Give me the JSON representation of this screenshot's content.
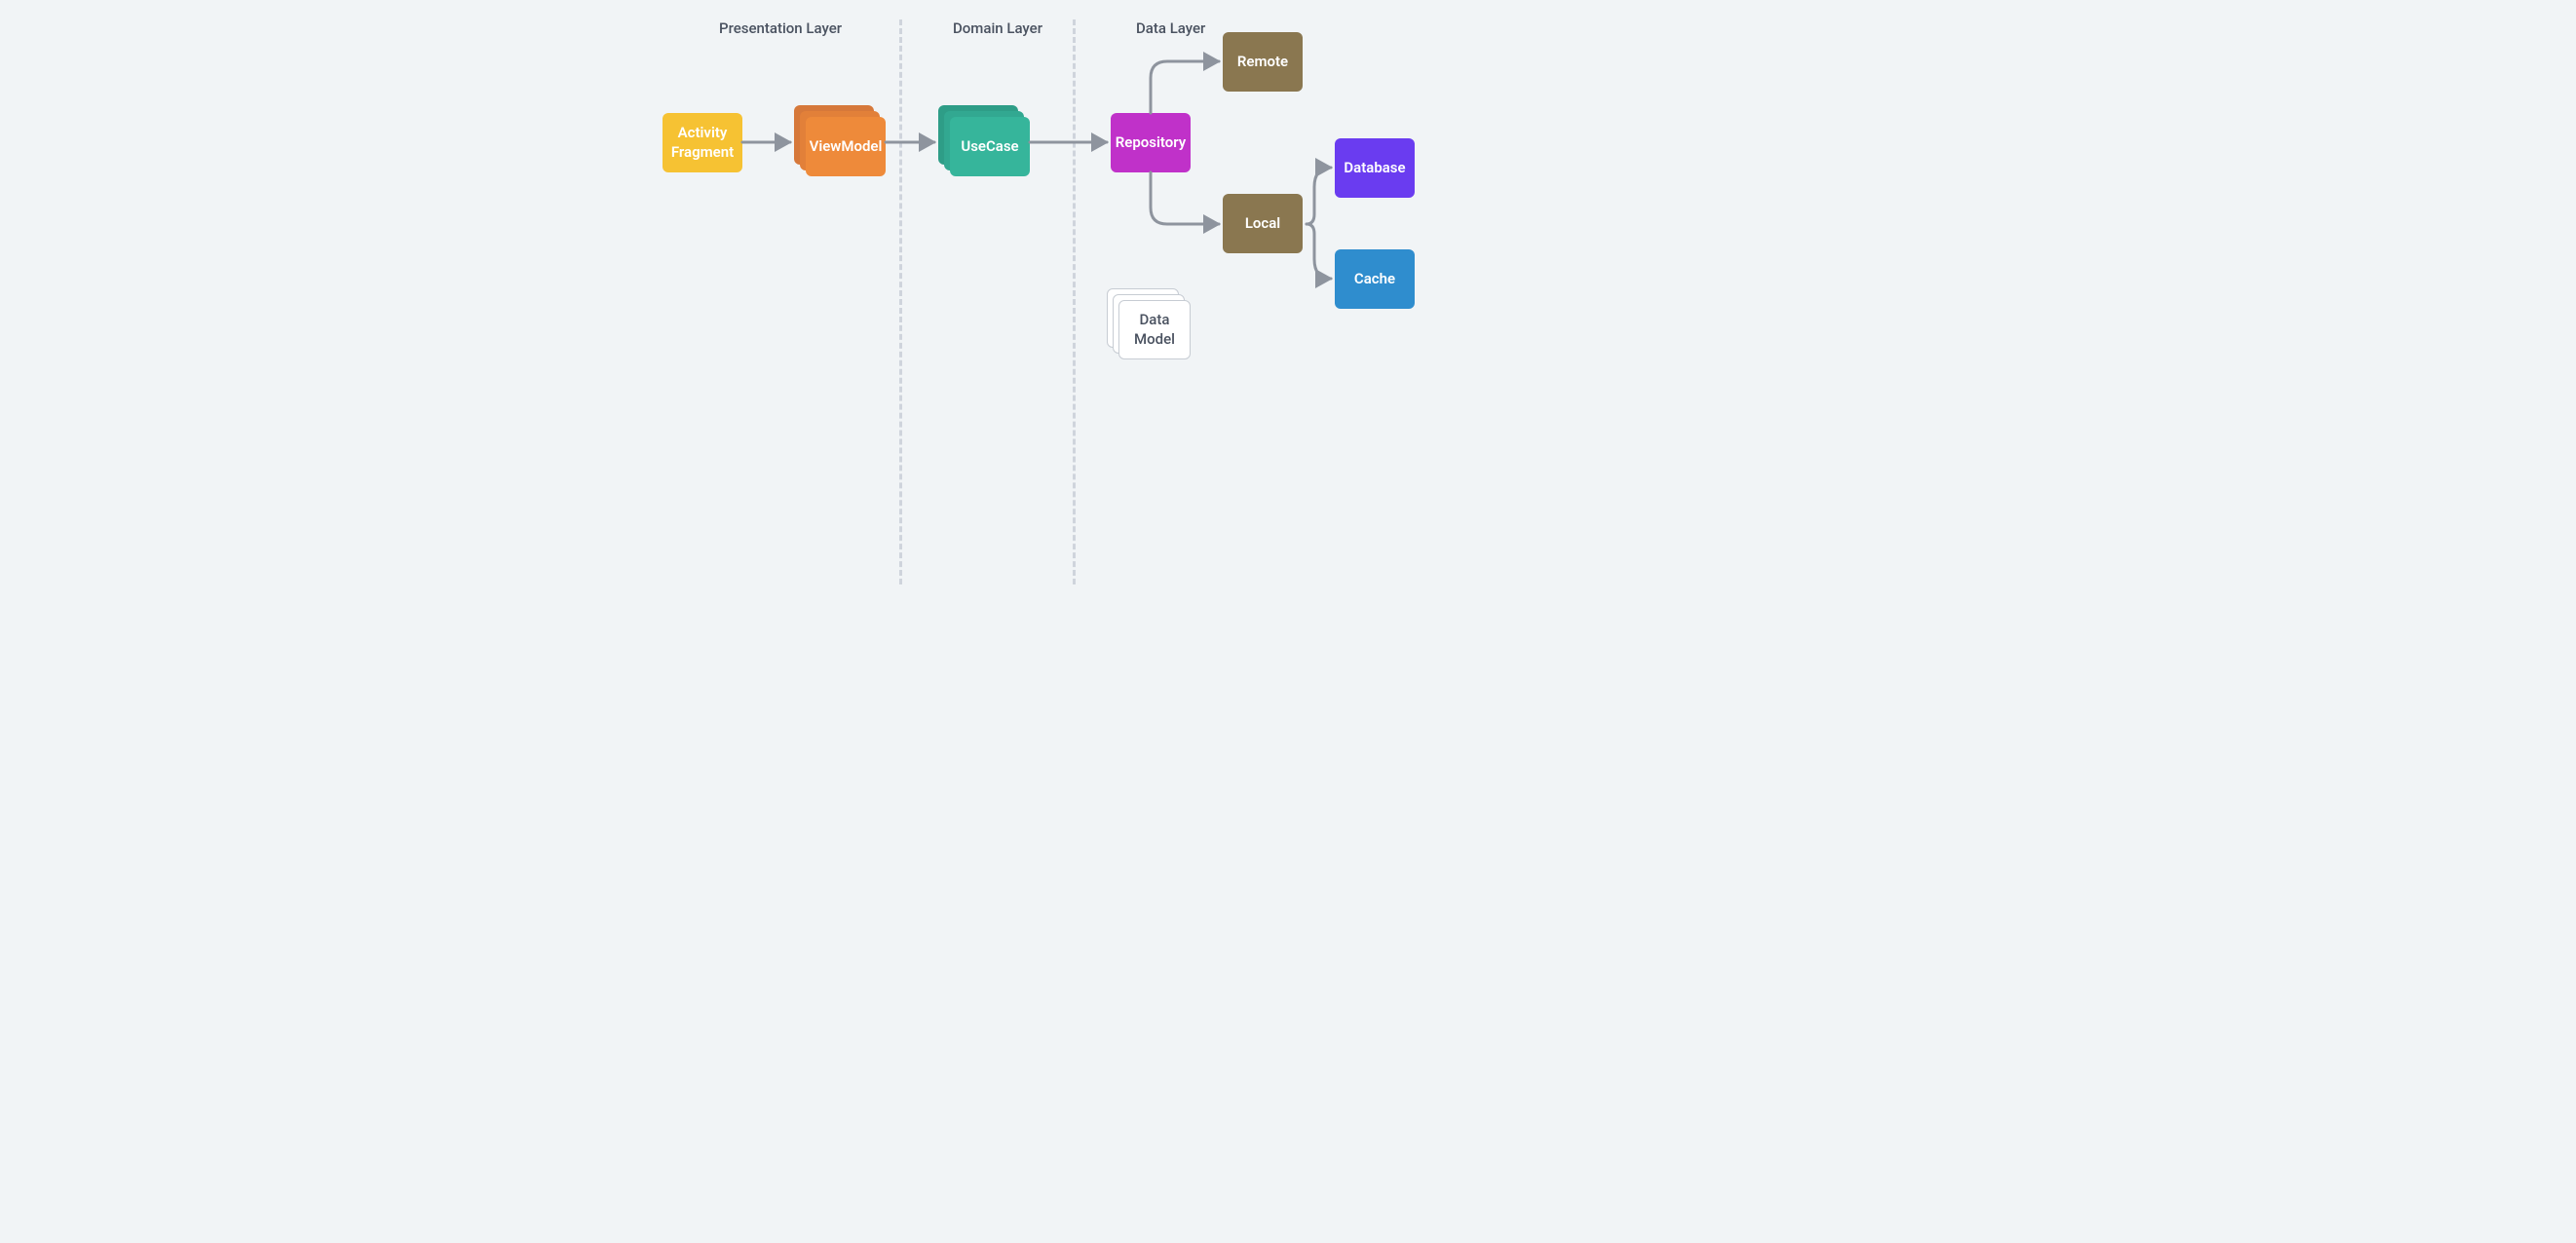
{
  "layers": {
    "presentation": "Presentation Layer",
    "domain": "Domain Layer",
    "data": "Data Layer"
  },
  "nodes": {
    "activity_fragment_l1": "Activity",
    "activity_fragment_l2": "Fragment",
    "viewmodel": "ViewModel",
    "usecase": "UseCase",
    "repository": "Repository",
    "remote": "Remote",
    "local": "Local",
    "database": "Database",
    "cache": "Cache",
    "datamodel_l1": "Data",
    "datamodel_l2": "Model"
  },
  "colors": {
    "yellow": "#f6c233",
    "orange": "#ee8a3a",
    "teal": "#36b59b",
    "magenta": "#c031c9",
    "brown": "#8a7750",
    "purple": "#6a3cf0",
    "blue": "#2f8dce",
    "arrow": "#8e949e",
    "dash": "#cfd4dc",
    "bg": "#f1f4f6"
  }
}
